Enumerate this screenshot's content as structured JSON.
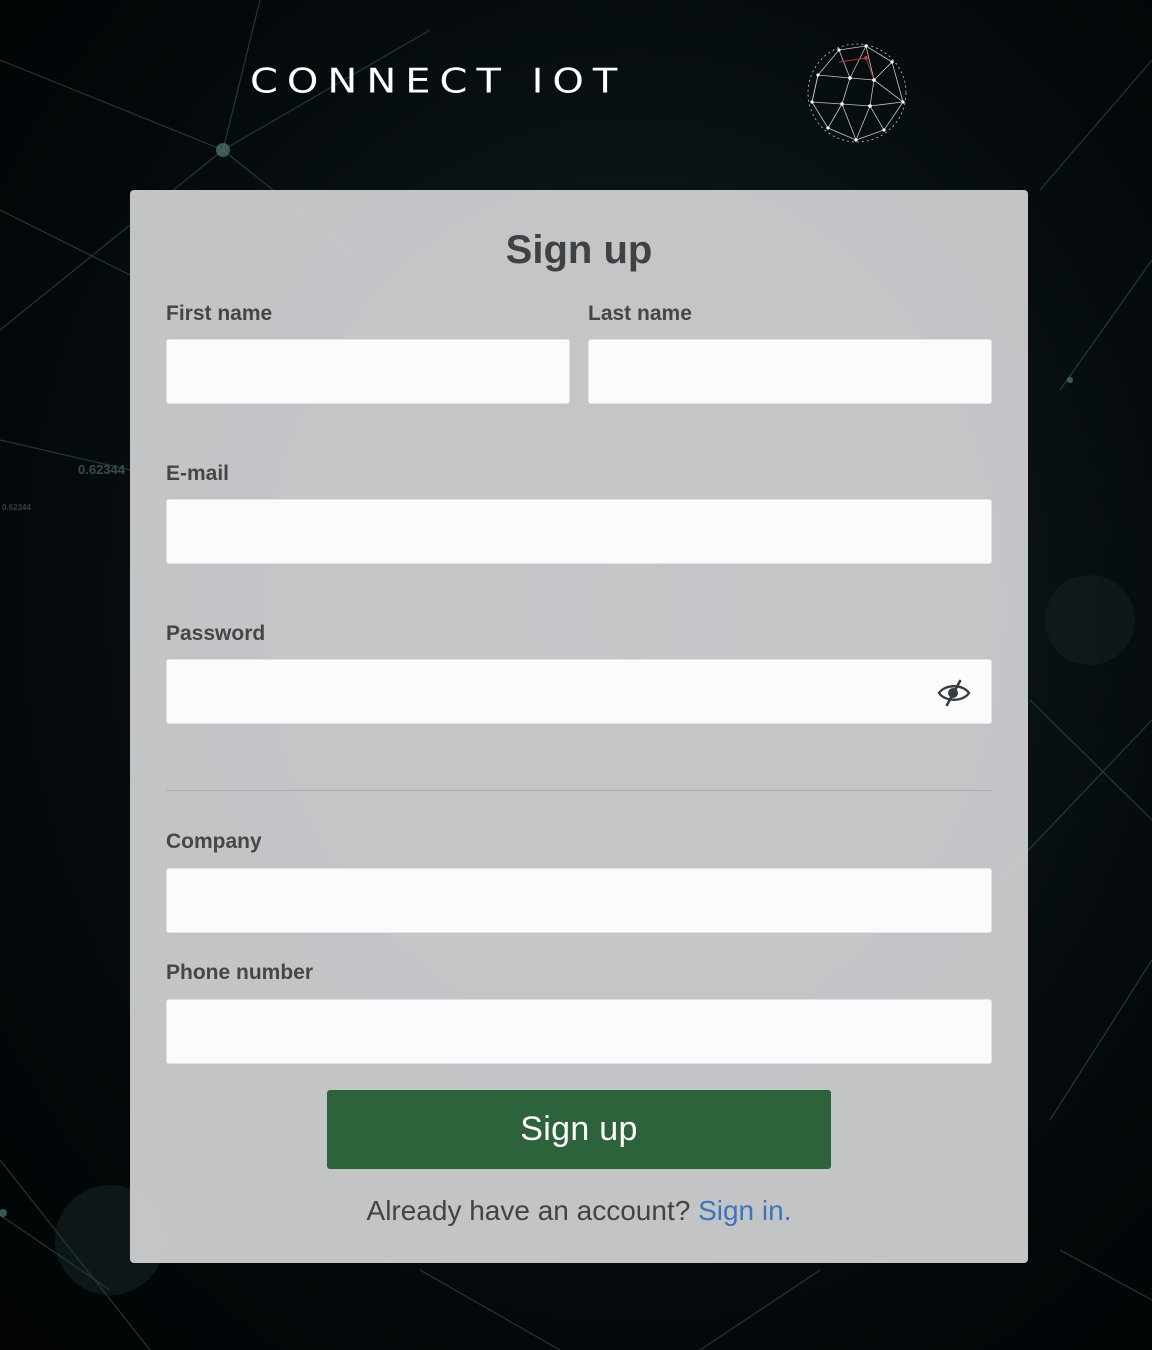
{
  "brand": {
    "logo_text": "CONNECT IOT",
    "globe_icon": "globe-network-icon"
  },
  "background": {
    "ghost_number_large": "0.62344",
    "ghost_number_small": "0.62344"
  },
  "form": {
    "title": "Sign up",
    "fields": {
      "first_name": {
        "label": "First name",
        "value": "",
        "placeholder": ""
      },
      "last_name": {
        "label": "Last name",
        "value": "",
        "placeholder": ""
      },
      "email": {
        "label": "E-mail",
        "value": "",
        "placeholder": ""
      },
      "password": {
        "label": "Password",
        "value": "",
        "placeholder": "",
        "toggle_icon": "eye-slash-icon"
      },
      "company": {
        "label": "Company",
        "value": "",
        "placeholder": ""
      },
      "phone": {
        "label": "Phone number",
        "value": "",
        "placeholder": ""
      }
    },
    "submit_label": "Sign up",
    "footer_text": "Already have an account? ",
    "footer_link": "Sign in."
  },
  "colors": {
    "button": "#2d633a",
    "link": "#3b74c1",
    "card": "#cdcfd1"
  }
}
